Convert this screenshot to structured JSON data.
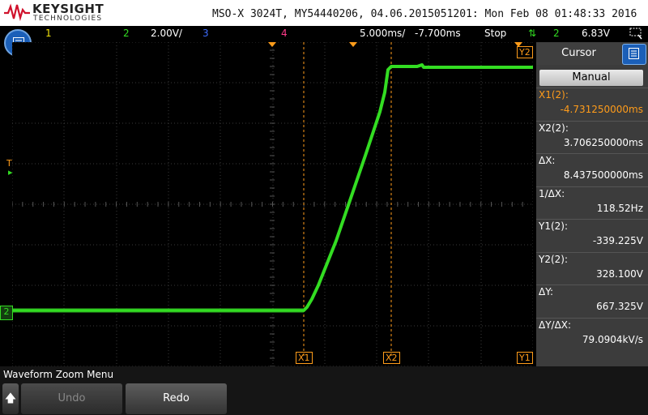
{
  "header": {
    "brand": "KEYSIGHT",
    "brand_sub": "TECHNOLOGIES",
    "info": "MSO-X 3024T, MY54440206, 04.06.2015051201: Mon Feb 08 01:48:33 2016"
  },
  "status": {
    "ch1": "1",
    "ch2": "2",
    "ch2_scale": "2.00V/",
    "ch3": "3",
    "ch4": "4",
    "timebase": "5.000ms/",
    "delay": "-7.700ms",
    "run_state": "Stop",
    "trigger_ch": "2",
    "trigger_level": "6.83V"
  },
  "markers": {
    "x1": "X1",
    "x2": "X2",
    "y1": "Y1",
    "y2": "Y2",
    "trig": "T",
    "ch2_ground": "2"
  },
  "side": {
    "title": "Cursor",
    "mode": "Manual",
    "fields": [
      {
        "label": "X1(2):",
        "value": "-4.731250000ms"
      },
      {
        "label": "X2(2):",
        "value": "3.706250000ms"
      },
      {
        "label": "ΔX:",
        "value": "8.437500000ms"
      },
      {
        "label": "1/ΔX:",
        "value": "118.52Hz"
      },
      {
        "label": "Y1(2):",
        "value": "-339.225V"
      },
      {
        "label": "Y2(2):",
        "value": "328.100V"
      },
      {
        "label": "ΔY:",
        "value": "667.325V"
      },
      {
        "label": "ΔY/ΔX:",
        "value": "79.0904kV/s"
      }
    ]
  },
  "bottom": {
    "menu_title": "Waveform Zoom Menu",
    "undo": "Undo",
    "redo": "Redo"
  },
  "colors": {
    "ch1": "#f2e20c",
    "ch2": "#33dd22",
    "ch3": "#3d6cff",
    "ch4": "#ff3b8a",
    "cursor": "#ff9c1a",
    "accent": "#1b5fb8"
  }
}
